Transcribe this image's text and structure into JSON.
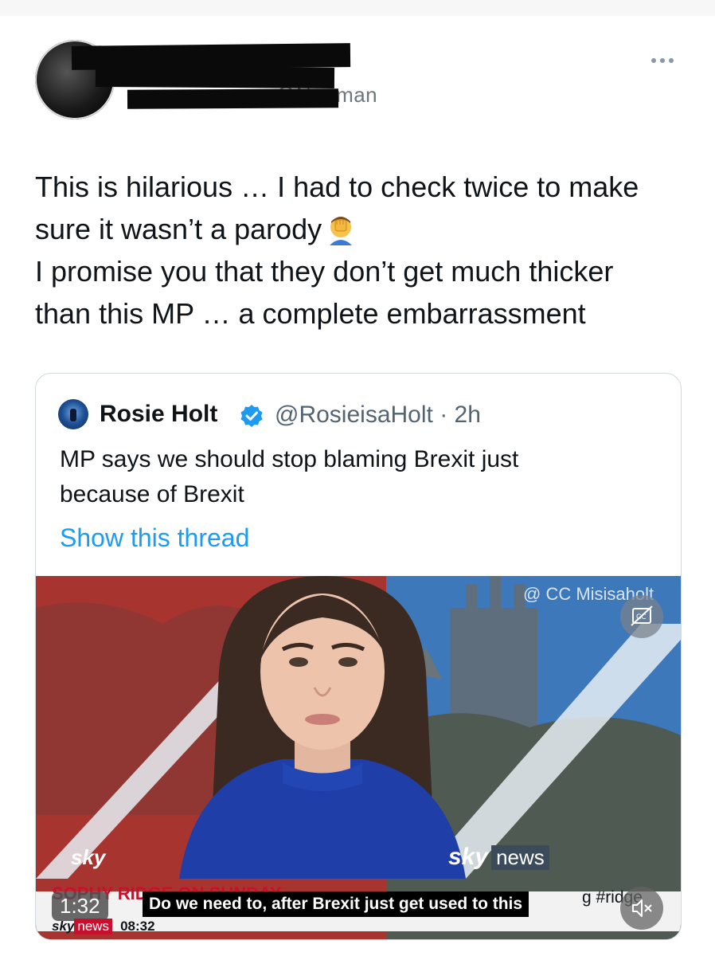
{
  "header": {
    "handle_fragment": "@N   ...man"
  },
  "tweet": {
    "lines": [
      "This is hilarious … I had to check twice to make",
      "sure it wasn’t a parody",
      "I promise you that they don’t get much thicker",
      "than this MP … a complete embarrassment"
    ],
    "emoji": "face-palm"
  },
  "quote": {
    "name": "Rosie Holt",
    "handle_time": "@RosieisaHolt · 2h",
    "lines": [
      "MP says we should stop blaming Brexit just",
      "because of Brexit"
    ],
    "show_thread": "Show this thread"
  },
  "video": {
    "cc_tag": "@ CC Misisaholt",
    "subtitle": "Do we need to, after Brexit just get used to this",
    "duration": "1:32",
    "ridge_tag": "g #ridge",
    "ticker_label": "SOPHY RIDGE ON SUNDAY",
    "logo_sky": "sky",
    "logo_news": "news",
    "strip_sky": "sky",
    "strip_news": "news",
    "strip_time": "08:32"
  },
  "colors": {
    "link": "#1d9bf0",
    "verified": "#1d9bf0",
    "secondary_text": "#536471"
  }
}
